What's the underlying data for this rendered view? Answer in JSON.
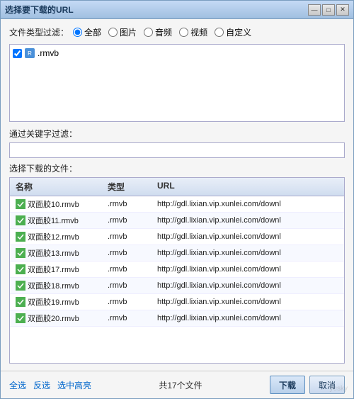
{
  "window": {
    "title": "选择要下载的URL",
    "close_btn": "✕",
    "minimize_btn": "—",
    "restore_btn": "□"
  },
  "filter": {
    "label": "文件类型过滤：",
    "options": [
      "全部",
      "图片",
      "音频",
      "视频",
      "自定义"
    ],
    "selected": "全部"
  },
  "checked_types": [
    {
      "label": ".rmvb",
      "checked": true,
      "icon": "rmvb"
    }
  ],
  "keyword": {
    "label": "通过关键字过滤：",
    "placeholder": "",
    "value": ""
  },
  "download_files": {
    "label": "选择下载的文件：",
    "headers": [
      "名称",
      "类型",
      "URL"
    ],
    "rows": [
      {
        "name": "双面胶10.rmvb",
        "type": ".rmvb",
        "url": "http://gdl.lixian.vip.xunlei.com/downl"
      },
      {
        "name": "双面胶11.rmvb",
        "type": ".rmvb",
        "url": "http://gdl.lixian.vip.xunlei.com/downl"
      },
      {
        "name": "双面胶12.rmvb",
        "type": ".rmvb",
        "url": "http://gdl.lixian.vip.xunlei.com/downl"
      },
      {
        "name": "双面胶13.rmvb",
        "type": ".rmvb",
        "url": "http://gdl.lixian.vip.xunlei.com/downl"
      },
      {
        "name": "双面胶17.rmvb",
        "type": ".rmvb",
        "url": "http://gdl.lixian.vip.xunlei.com/downl"
      },
      {
        "name": "双面胶18.rmvb",
        "type": ".rmvb",
        "url": "http://gdl.lixian.vip.xunlei.com/downl"
      },
      {
        "name": "双面胶19.rmvb",
        "type": ".rmvb",
        "url": "http://gdl.lixian.vip.xunlei.com/downl"
      },
      {
        "name": "双面胶20.rmvb",
        "type": ".rmvb",
        "url": "http://gdl.lixian.vip.xunlei.com/downl"
      }
    ]
  },
  "bottom": {
    "select_all": "全选",
    "invert": "反选",
    "highlight": "选中高亮",
    "file_count": "共17个文件",
    "download": "下载",
    "cancel": "取消"
  },
  "watermark": "yesky"
}
